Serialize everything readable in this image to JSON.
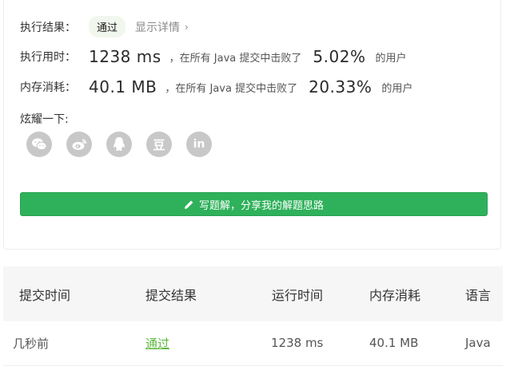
{
  "result": {
    "label": "执行结果：",
    "status": "通过",
    "details_link": "显示详情"
  },
  "runtime": {
    "label": "执行用时：",
    "value": "1238 ms",
    "mid_text": "，在所有 Java 提交中击败了",
    "percent": "5.02%",
    "suffix": "的用户"
  },
  "memory": {
    "label": "内存消耗：",
    "value": "40.1 MB",
    "mid_text": "，在所有 Java 提交中击败了",
    "percent": "20.33%",
    "suffix": "的用户"
  },
  "share": {
    "label": "炫耀一下:",
    "icons": [
      "wechat-icon",
      "weibo-icon",
      "qq-icon",
      "douban-icon",
      "linkedin-icon"
    ],
    "douban_glyph": "豆",
    "linkedin_glyph": "in"
  },
  "write_button": {
    "label": "写题解，分享我的解题思路",
    "color": "#2eb15a"
  },
  "table": {
    "headers": [
      "提交时间",
      "提交结果",
      "运行时间",
      "内存消耗",
      "语言"
    ],
    "rows": [
      {
        "time": "几秒前",
        "result": "通过",
        "runtime": "1238 ms",
        "memory": "40.1 MB",
        "language": "Java"
      }
    ],
    "status_color": "#5cb83c"
  }
}
